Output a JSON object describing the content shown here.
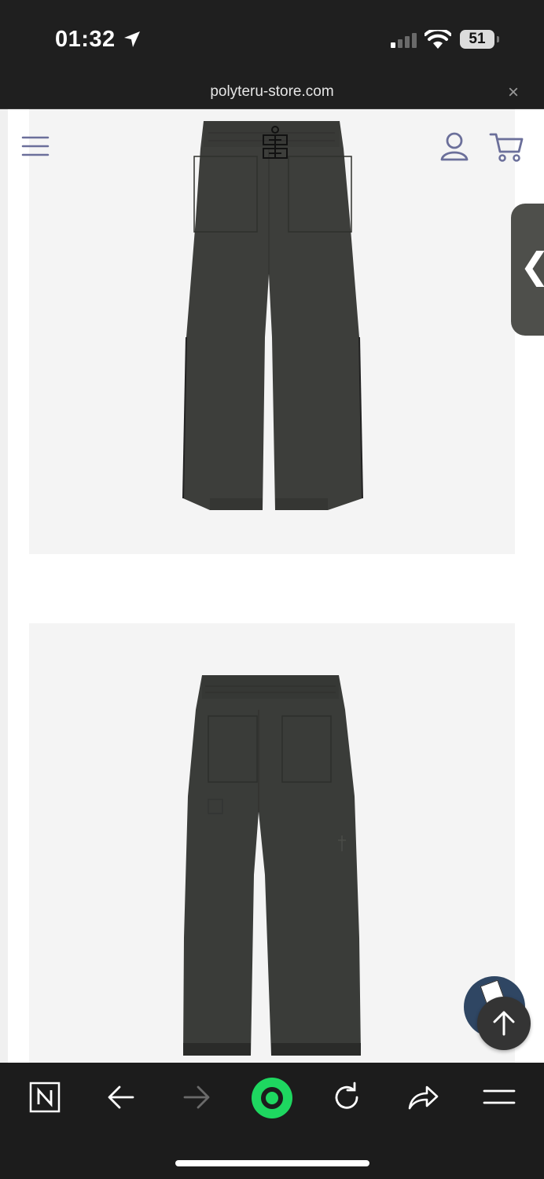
{
  "status_bar": {
    "time": "01:32",
    "battery": "51"
  },
  "address_bar": {
    "url": "polyteru-store.com",
    "close_label": "×"
  },
  "site_header": {
    "menu_icon": "hamburger-icon",
    "account_icon": "user-icon",
    "cart_icon": "cart-icon"
  },
  "side_tab": {
    "label": "❮"
  },
  "product_images": [
    {
      "view": "front",
      "color": "#3d3e3b"
    },
    {
      "view": "back",
      "color": "#3a3c39"
    }
  ],
  "floating": {
    "chat_logo_text": "폴리\n테루",
    "top_icon": "arrow-up-icon"
  },
  "browser_toolbar": {
    "items": [
      "naver-icon",
      "back-arrow-icon",
      "forward-arrow-icon",
      "green-dot-icon",
      "reload-icon",
      "share-icon",
      "menu-icon"
    ]
  },
  "colors": {
    "accent": "#6b6f9a",
    "toolbar": "#1c1c1c",
    "green": "#1ed760"
  }
}
